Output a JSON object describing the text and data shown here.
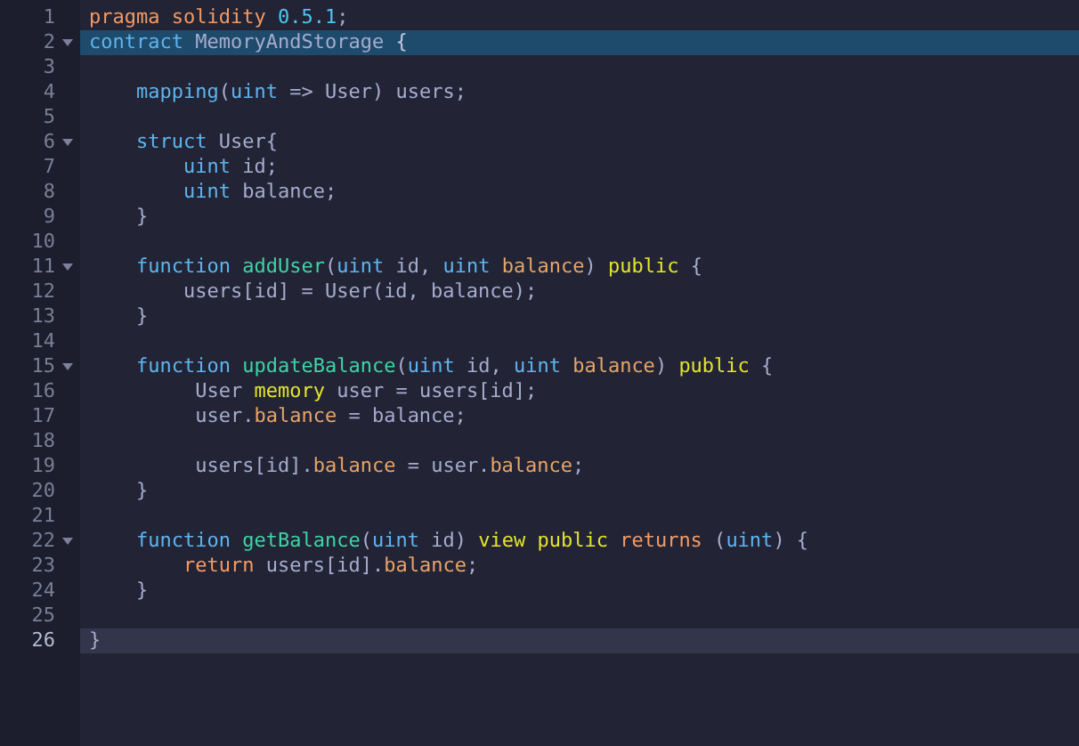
{
  "editor": {
    "lines": [
      {
        "number": "1",
        "fold": false,
        "selected": false,
        "active": false,
        "tokens": [
          {
            "kind": "keyword",
            "text": "pragma"
          },
          {
            "kind": "keyword",
            "text": " solidity"
          },
          {
            "kind": "number",
            "text": " 0.5.1"
          },
          {
            "kind": "plain",
            "text": ";"
          }
        ]
      },
      {
        "number": "2",
        "fold": true,
        "selected": true,
        "active": false,
        "tokens": [
          {
            "kind": "storage",
            "text": "contract"
          },
          {
            "kind": "plain",
            "text": " MemoryAndStorage"
          },
          {
            "kind": "bracket",
            "text": " {"
          }
        ]
      },
      {
        "number": "3",
        "fold": false,
        "selected": false,
        "active": false
      },
      {
        "number": "4",
        "fold": false,
        "selected": false,
        "active": false,
        "tokens": [
          {
            "kind": "storage",
            "text": "    mapping"
          },
          {
            "kind": "plain",
            "text": "("
          },
          {
            "kind": "storage",
            "text": "uint"
          },
          {
            "kind": "plain",
            "text": " => User) users;"
          }
        ]
      },
      {
        "number": "5",
        "fold": false,
        "selected": false,
        "active": false
      },
      {
        "number": "6",
        "fold": true,
        "selected": false,
        "active": false,
        "tokens": [
          {
            "kind": "storage",
            "text": "    struct"
          },
          {
            "kind": "plain",
            "text": " User{"
          }
        ]
      },
      {
        "number": "7",
        "fold": false,
        "selected": false,
        "active": false,
        "tokens": [
          {
            "kind": "storage",
            "text": "        uint"
          },
          {
            "kind": "plain",
            "text": " id;"
          }
        ]
      },
      {
        "number": "8",
        "fold": false,
        "selected": false,
        "active": false,
        "tokens": [
          {
            "kind": "storage",
            "text": "        uint"
          },
          {
            "kind": "plain",
            "text": " balance;"
          }
        ]
      },
      {
        "number": "9",
        "fold": false,
        "selected": false,
        "active": false,
        "tokens": [
          {
            "kind": "plain",
            "text": "    }"
          }
        ]
      },
      {
        "number": "10",
        "fold": false,
        "selected": false,
        "active": false
      },
      {
        "number": "11",
        "fold": true,
        "selected": false,
        "active": false,
        "tokens": [
          {
            "kind": "storage",
            "text": "    function"
          },
          {
            "kind": "function",
            "text": " addUser"
          },
          {
            "kind": "plain",
            "text": "("
          },
          {
            "kind": "storage",
            "text": "uint"
          },
          {
            "kind": "plain",
            "text": " id, "
          },
          {
            "kind": "storage",
            "text": "uint"
          },
          {
            "kind": "param",
            "text": " balance"
          },
          {
            "kind": "plain",
            "text": ") "
          },
          {
            "kind": "modifier",
            "text": "public"
          },
          {
            "kind": "plain",
            "text": " {"
          }
        ]
      },
      {
        "number": "12",
        "fold": false,
        "selected": false,
        "active": false,
        "tokens": [
          {
            "kind": "plain",
            "text": "        users[id] = User(id, balance);"
          }
        ]
      },
      {
        "number": "13",
        "fold": false,
        "selected": false,
        "active": false,
        "tokens": [
          {
            "kind": "plain",
            "text": "    }"
          }
        ]
      },
      {
        "number": "14",
        "fold": false,
        "selected": false,
        "active": false
      },
      {
        "number": "15",
        "fold": true,
        "selected": false,
        "active": false,
        "tokens": [
          {
            "kind": "storage",
            "text": "    function"
          },
          {
            "kind": "function",
            "text": " updateBalance"
          },
          {
            "kind": "plain",
            "text": "("
          },
          {
            "kind": "storage",
            "text": "uint"
          },
          {
            "kind": "plain",
            "text": " id, "
          },
          {
            "kind": "storage",
            "text": "uint"
          },
          {
            "kind": "param",
            "text": " balance"
          },
          {
            "kind": "plain",
            "text": ") "
          },
          {
            "kind": "modifier",
            "text": "public"
          },
          {
            "kind": "plain",
            "text": " {"
          }
        ]
      },
      {
        "number": "16",
        "fold": false,
        "selected": false,
        "active": false,
        "tokens": [
          {
            "kind": "plain",
            "text": "         User "
          },
          {
            "kind": "modifier",
            "text": "memory"
          },
          {
            "kind": "plain",
            "text": " user = users[id];"
          }
        ]
      },
      {
        "number": "17",
        "fold": false,
        "selected": false,
        "active": false,
        "tokens": [
          {
            "kind": "plain",
            "text": "         user."
          },
          {
            "kind": "param",
            "text": "balance"
          },
          {
            "kind": "plain",
            "text": " = balance;"
          }
        ]
      },
      {
        "number": "18",
        "fold": false,
        "selected": false,
        "active": false
      },
      {
        "number": "19",
        "fold": false,
        "selected": false,
        "active": false,
        "tokens": [
          {
            "kind": "plain",
            "text": "         users[id]."
          },
          {
            "kind": "param",
            "text": "balance"
          },
          {
            "kind": "plain",
            "text": " = user."
          },
          {
            "kind": "param",
            "text": "balance"
          },
          {
            "kind": "plain",
            "text": ";"
          }
        ]
      },
      {
        "number": "20",
        "fold": false,
        "selected": false,
        "active": false,
        "tokens": [
          {
            "kind": "plain",
            "text": "    }"
          }
        ]
      },
      {
        "number": "21",
        "fold": false,
        "selected": false,
        "active": false
      },
      {
        "number": "22",
        "fold": true,
        "selected": false,
        "active": false,
        "tokens": [
          {
            "kind": "storage",
            "text": "    function"
          },
          {
            "kind": "function",
            "text": " getBalance"
          },
          {
            "kind": "plain",
            "text": "("
          },
          {
            "kind": "storage",
            "text": "uint"
          },
          {
            "kind": "plain",
            "text": " id) "
          },
          {
            "kind": "modifier",
            "text": "view"
          },
          {
            "kind": "modifier",
            "text": " public"
          },
          {
            "kind": "keyword",
            "text": " returns"
          },
          {
            "kind": "plain",
            "text": " ("
          },
          {
            "kind": "storage",
            "text": "uint"
          },
          {
            "kind": "plain",
            "text": ") {"
          }
        ]
      },
      {
        "number": "23",
        "fold": false,
        "selected": false,
        "active": false,
        "tokens": [
          {
            "kind": "keyword",
            "text": "        return"
          },
          {
            "kind": "plain",
            "text": " users[id]."
          },
          {
            "kind": "param",
            "text": "balance"
          },
          {
            "kind": "plain",
            "text": ";"
          }
        ]
      },
      {
        "number": "24",
        "fold": false,
        "selected": false,
        "active": false,
        "tokens": [
          {
            "kind": "plain",
            "text": "    }"
          }
        ]
      },
      {
        "number": "25",
        "fold": false,
        "selected": false,
        "active": false
      },
      {
        "number": "26",
        "fold": false,
        "selected": false,
        "active": true,
        "tokens": [
          {
            "kind": "plain",
            "text": "}"
          }
        ]
      }
    ]
  }
}
